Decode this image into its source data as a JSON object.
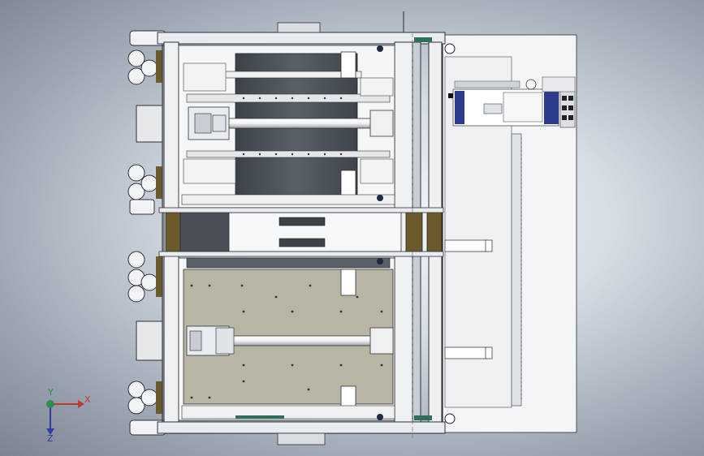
{
  "axes": {
    "x_label": "X",
    "y_label": "Y",
    "z_label": "Z"
  },
  "colors": {
    "frame": "#e9ecef",
    "frame_dark": "#5f6670",
    "plate_dark": "#4b5058",
    "plate_tan": "#b8b5a4",
    "bracket_olive": "#6b5a2c",
    "accent_blue": "#2c3c8a",
    "accent_green": "#2f6f5a"
  },
  "icons": {
    "triad": "coordinate-triad-icon"
  }
}
